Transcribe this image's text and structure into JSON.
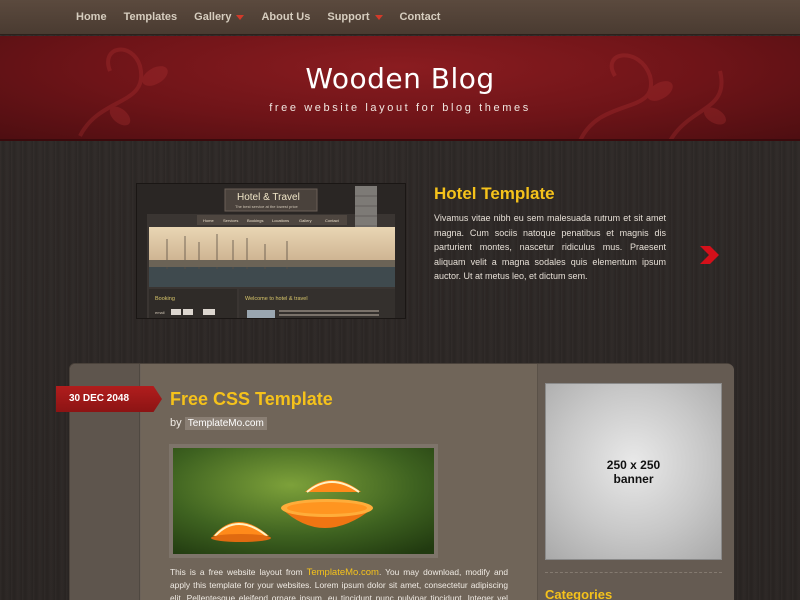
{
  "nav": {
    "items": [
      {
        "label": "Home",
        "has_submenu": false
      },
      {
        "label": "Templates",
        "has_submenu": false
      },
      {
        "label": "Gallery",
        "has_submenu": true
      },
      {
        "label": "About Us",
        "has_submenu": false
      },
      {
        "label": "Support",
        "has_submenu": true
      },
      {
        "label": "Contact",
        "has_submenu": false
      }
    ]
  },
  "header": {
    "title": "Wooden Blog",
    "tagline": "free website layout for blog themes"
  },
  "featured": {
    "thumbnail": {
      "title": "Hotel & Travel",
      "subtitle": "The best service at the lowest price",
      "menu": [
        "Home",
        "Services",
        "Bookings",
        "Locations",
        "Gallery",
        "Contact"
      ],
      "left_heading": "Booking",
      "right_heading": "Welcome to hotel & travel",
      "field_label": "email"
    },
    "title": "Hotel Template",
    "text": "Vivamus vitae nibh eu sem malesuada rutrum et sit amet magna. Cum sociis natoque penatibus et magnis dis parturient montes, nascetur ridiculus mus. Praesent aliquam velit a magna sodales quis elementum ipsum auctor. Ut at metus leo, et dictum sem.",
    "next_icon": "chevron-right-icon"
  },
  "post": {
    "date": "30 DEC 2048",
    "title": "Free CSS Template",
    "by_prefix": "by",
    "author": "TemplateMo.com",
    "image_icon": "orange-photo",
    "text_before": "This is a free website layout from ",
    "text_link": "TemplateMo.com",
    "text_after": ". You may download, modify and apply this template for your websites. Lorem ipsum dolor sit amet, consectetur adipiscing elit. Pellentesque eleifend ornare ipsum, eu tincidunt nunc pulvinar tincidunt. Integer vel erat purus, quis pulvinar"
  },
  "sidebar": {
    "banner_line1": "250 x 250",
    "banner_line2": "banner",
    "categories_heading": "Categories"
  },
  "colors": {
    "accent": "#f5c21b",
    "header_red": "#7a161a",
    "ribbon_red": "#a01818",
    "wood_dark": "#2c2725"
  }
}
